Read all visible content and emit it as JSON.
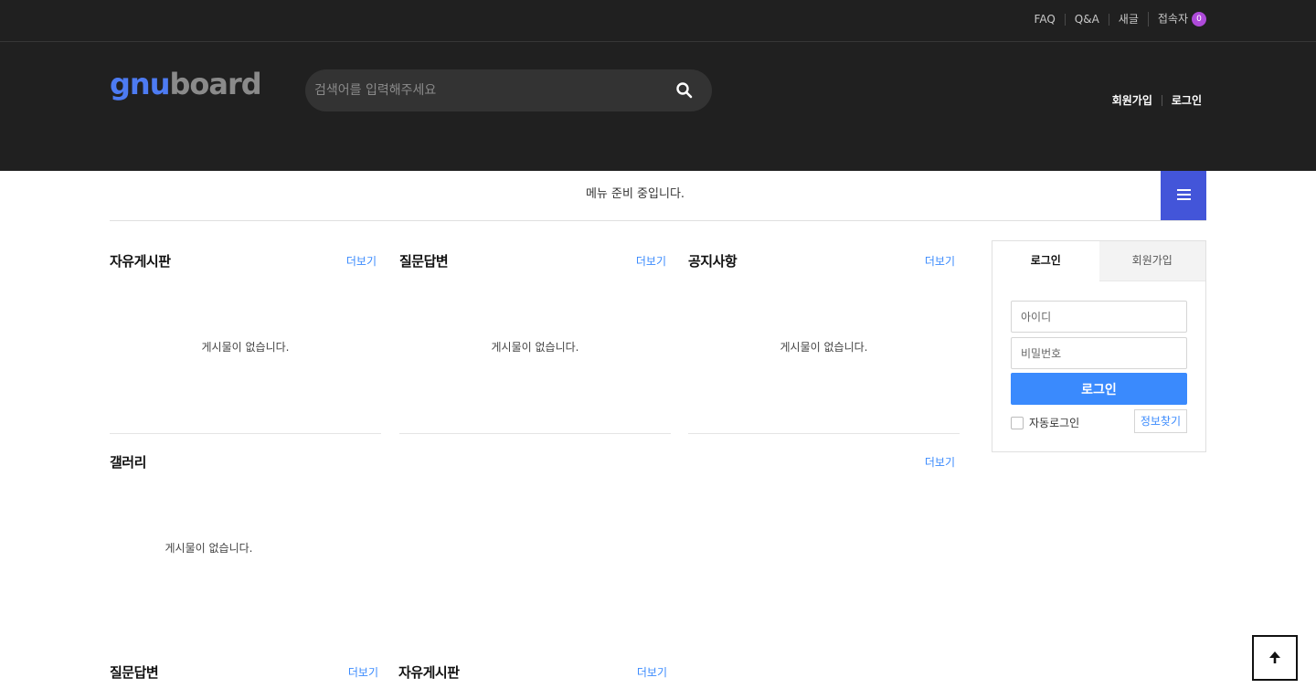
{
  "top_bar": {
    "links": [
      "FAQ",
      "Q&A",
      "새글",
      "접속자"
    ],
    "visitor_count": "0"
  },
  "header": {
    "logo_part_a": "gnu",
    "logo_part_b": "board",
    "search_placeholder": "검색어를 입력해주세요",
    "links": [
      "회원가입",
      "로그인"
    ]
  },
  "nav": {
    "text": "메뉴 준비 중입니다."
  },
  "boards": [
    {
      "title": "자유게시판",
      "more": "더보기",
      "empty": "게시물이 없습니다."
    },
    {
      "title": "질문답변",
      "more": "더보기",
      "empty": "게시물이 없습니다."
    },
    {
      "title": "공지사항",
      "more": "더보기",
      "empty": "게시물이 없습니다."
    }
  ],
  "gallery": {
    "title": "갤러리",
    "more": "더보기",
    "empty": "게시물이 없습니다."
  },
  "bottom_boards": [
    {
      "title": "질문답변",
      "more": "더보기"
    },
    {
      "title": "자유게시판",
      "more": "더보기"
    }
  ],
  "login": {
    "tab_login": "로그인",
    "tab_join": "회원가입",
    "id_placeholder": "아이디",
    "pw_placeholder": "비밀번호",
    "submit": "로그인",
    "auto_login": "자동로그인",
    "find_info": "정보찾기"
  },
  "colors": {
    "header_bg": "#202020",
    "accent_blue": "#3a8afd",
    "menu_button": "#4355d9",
    "badge": "#ae4ad9"
  }
}
